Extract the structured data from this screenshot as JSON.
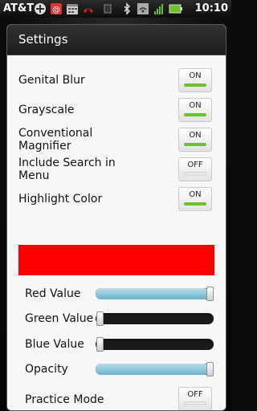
{
  "status_bar": {
    "carrier": "AT&T",
    "time": "10:10",
    "icons": [
      "plus-icon",
      "email-icon",
      "calendar-icon",
      "missed-call-icon",
      "usb-icon",
      "bluetooth-icon",
      "wifi-icon",
      "signal-icon",
      "battery-icon"
    ]
  },
  "dialog": {
    "title": "Settings",
    "rows": [
      {
        "label": "Genital Blur",
        "state": "ON"
      },
      {
        "label": "Grayscale",
        "state": "ON"
      },
      {
        "label": "Conventional Magnifier",
        "state": "ON"
      },
      {
        "label": "Include Search in Menu",
        "state": "OFF"
      },
      {
        "label": "Highlight Color",
        "state": "ON"
      }
    ],
    "highlight_color": "#ff0000",
    "sliders": [
      {
        "label": "Red Value",
        "value_fraction": 1.0
      },
      {
        "label": "Green Value",
        "value_fraction": 0.0
      },
      {
        "label": "Blue Value",
        "value_fraction": 0.0
      },
      {
        "label": "Opacity",
        "value_fraction": 1.0
      }
    ],
    "practice_mode": {
      "label": "Practice Mode",
      "state": "OFF"
    }
  },
  "colors": {
    "on_indicator": "#6cc12a",
    "slider_fill": "#6bb2cf"
  }
}
